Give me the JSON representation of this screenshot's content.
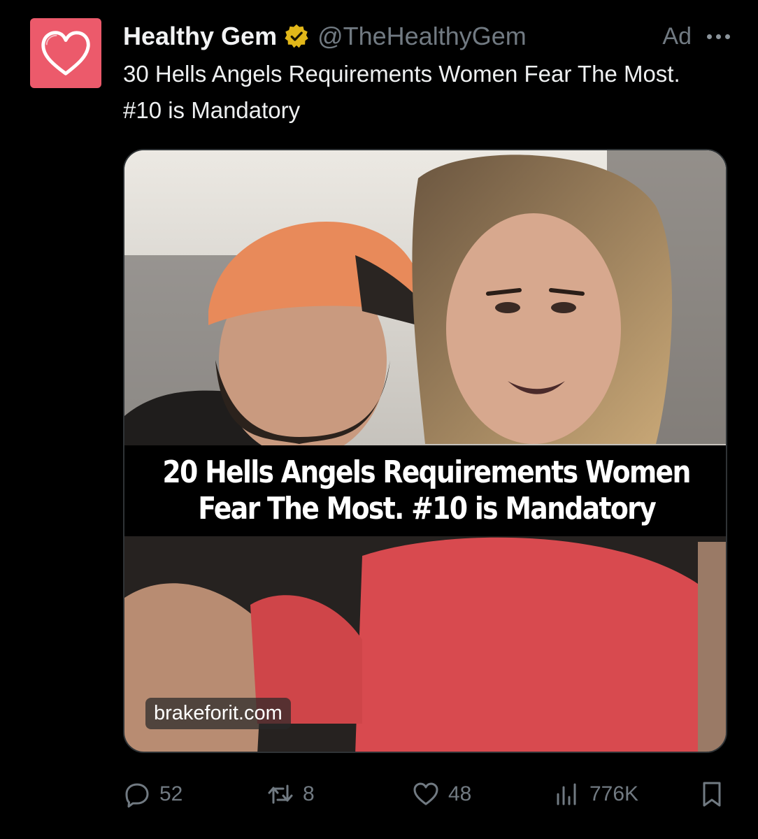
{
  "author": {
    "display_name": "Healthy Gem",
    "handle": "@TheHealthyGem",
    "verified_icon": "gold-verified-badge-icon",
    "avatar_color": "#ec5a6b"
  },
  "ad_label": "Ad",
  "tweet": {
    "text": "30 Hells Angels Requirements Women Fear The Most. #10 is Mandatory"
  },
  "media": {
    "caption_line1": "20 Hells Angels Requirements Women",
    "caption_line2": "Fear The Most. #10 is Mandatory",
    "domain": "brakeforit.com"
  },
  "actions": {
    "replies": "52",
    "reposts": "8",
    "likes": "48",
    "views": "776K"
  },
  "colors": {
    "background": "#000000",
    "text_primary": "#e7e9ea",
    "text_secondary": "#717a82",
    "verified_gold": "#e2b719"
  }
}
